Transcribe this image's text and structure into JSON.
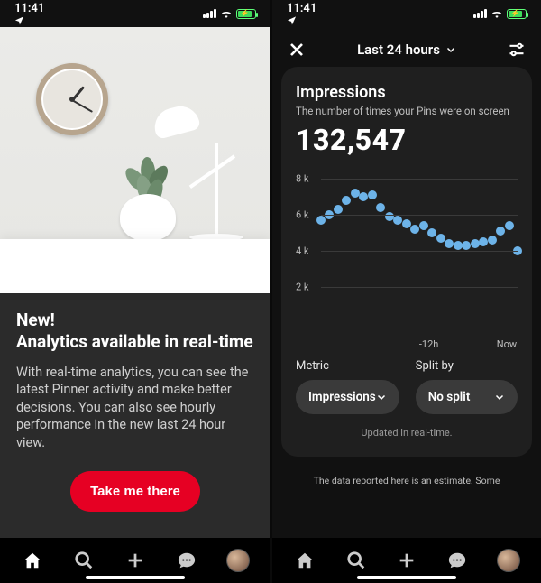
{
  "status": {
    "time": "11:41",
    "loc_icon": "location-arrow"
  },
  "left": {
    "promoLead1": "New!",
    "promoLead2": "Analytics available in real-time",
    "promoBody": "With real-time analytics, you can see the latest Pinner activity and make better decisions. You can also see hourly performance in the new last 24 hour view.",
    "cta": "Take me there"
  },
  "right": {
    "range": "Last 24 hours",
    "metricTitle": "Impressions",
    "metricSub": "The number of times your Pins were on screen",
    "metricValue": "132,547",
    "controls": {
      "metricLabel": "Metric",
      "metricValue": "Impressions",
      "splitLabel": "Split by",
      "splitValue": "No split"
    },
    "updated": "Updated in real-time.",
    "footnote": "The data reported here is an estimate. Some"
  },
  "chart_data": {
    "type": "line",
    "title": "Impressions",
    "ylabel": "",
    "xlabel": "",
    "ylim": [
      0,
      8500
    ],
    "y_ticks": [
      2000,
      4000,
      6000,
      8000
    ],
    "y_tick_labels": [
      "2 k",
      "4 k",
      "6 k",
      "8 k"
    ],
    "x_tick_labels": [
      "-12h",
      "Now"
    ],
    "x": [
      0,
      1,
      2,
      3,
      4,
      5,
      6,
      7,
      8,
      9,
      10,
      11,
      12,
      13,
      14,
      15,
      16,
      17,
      18,
      19,
      20,
      21,
      22,
      23
    ],
    "values": [
      5700,
      6000,
      6300,
      6800,
      7200,
      7000,
      7100,
      6400,
      5900,
      5700,
      5500,
      5200,
      5400,
      5000,
      4700,
      4400,
      4300,
      4300,
      4400,
      4500,
      4600,
      5100,
      5400,
      4000
    ]
  }
}
